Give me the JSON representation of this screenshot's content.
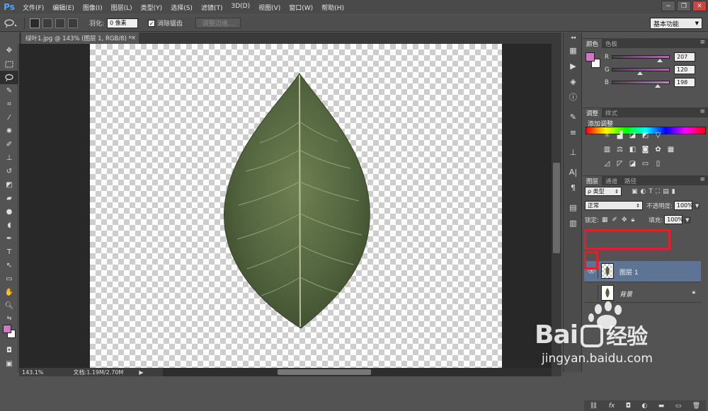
{
  "app": {
    "logo": "Ps"
  },
  "menu": [
    "文件(F)",
    "编辑(E)",
    "图像(I)",
    "图层(L)",
    "类型(Y)",
    "选择(S)",
    "滤镜(T)",
    "3D(D)",
    "视图(V)",
    "窗口(W)",
    "帮助(H)"
  ],
  "window_buttons": [
    "−",
    "❐",
    "✕"
  ],
  "options": {
    "feather_label": "羽化:",
    "feather_value": "0 像素",
    "antialias_label": "消除锯齿",
    "antialias_checked": true,
    "refine_edge": "调整边缘...",
    "workspace": "基本功能"
  },
  "document": {
    "tab_title": "绿叶1.jpg @ 143% (图层 1, RGB/8) *",
    "zoom": "143.1%",
    "doc_size": "文档:1.19M/2.70M"
  },
  "color_panel": {
    "tabs": [
      "颜色",
      "色板"
    ],
    "channels": [
      {
        "label": "R",
        "value": "207",
        "gradient": "#e04ae0"
      },
      {
        "label": "G",
        "value": "120",
        "gradient": "#cf4fd0"
      },
      {
        "label": "B",
        "value": "198",
        "gradient": "#cf7ad0"
      }
    ],
    "foreground": "#cf78c6",
    "background": "#ffffff"
  },
  "adjust_panel": {
    "tabs": [
      "调整",
      "样式"
    ],
    "title": "添加调整"
  },
  "layers_panel": {
    "tabs": [
      "图层",
      "通道",
      "路径"
    ],
    "filter": "ρ 类型",
    "blend_mode": "正常",
    "opacity_label": "不透明度:",
    "opacity": "100%",
    "lock_label": "锁定:",
    "fill_label": "填充:",
    "fill": "100%",
    "layers": [
      {
        "name": "图层 1",
        "selected": true,
        "visible": true
      },
      {
        "name": "背景",
        "selected": false,
        "visible": false,
        "locked": true
      }
    ]
  },
  "watermark": {
    "brand_a": "Bai",
    "brand_b": "经验",
    "url": "jingyan.baidu.com"
  },
  "colors": {
    "accent": "#4ea7ff",
    "selection": "#5e7494",
    "highlight": "#e0202a"
  }
}
